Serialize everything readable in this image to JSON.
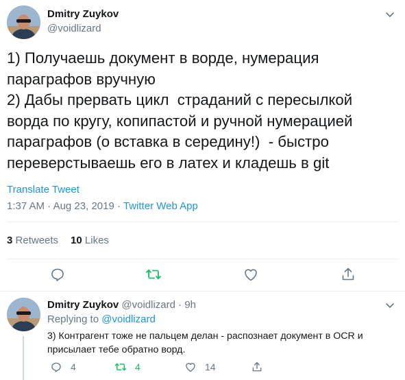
{
  "tweet": {
    "author_name": "Dmitry Zuykov",
    "author_handle": "@voidlizard",
    "text": "1) Получаешь документ в ворде, нумерация параграфов вручную\n2) Дабы прервать цикл  страданий с пересылкой ворда по кругу, копипастой и ручной нумерацией параграфов (о вставка в середину!)  - быстро переверстываешь его в латех и кладешь в git",
    "translate_label": "Translate Tweet",
    "time": "1:37 AM",
    "date": "Aug 23, 2019",
    "separator": "·",
    "source_app": "Twitter Web App",
    "retweets_count": "3",
    "retweets_label": "Retweets",
    "likes_count": "10",
    "likes_label": "Likes"
  },
  "reply": {
    "author_name": "Dmitry Zuykov",
    "author_handle": "@voidlizard",
    "separator": "·",
    "age": "9h",
    "replying_prefix": "Replying to",
    "replying_to": "@voidlizard",
    "text": "3) Контрагент тоже не пальцем  делан - распознает документ в OCR и присылает тебе обратно ворд.",
    "reply_count": "4",
    "retweet_count": "4",
    "like_count": "14"
  },
  "colors": {
    "link": "#1b95e0",
    "secondary_text": "#657786",
    "retweet_green": "#17bf63",
    "divider": "#e6ecf0"
  },
  "icons": [
    "chevron-down-icon",
    "reply-icon",
    "retweet-icon",
    "like-icon",
    "share-icon"
  ]
}
